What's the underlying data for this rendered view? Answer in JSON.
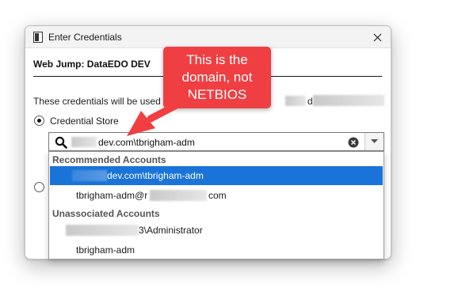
{
  "window": {
    "title": "Enter Credentials",
    "app_icon": "door-icon",
    "close_icon": "close-icon"
  },
  "header": {
    "title": "Web Jump: DataEDO DEV"
  },
  "description": {
    "text": "These credentials will be used to",
    "tail": "d"
  },
  "options": {
    "credential_store_label": "Credential Store"
  },
  "combo": {
    "value": "dev.com\\tbrigham-adm",
    "search_icon": "search-icon",
    "clear_icon": "clear-icon",
    "dropdown_icon": "chevron-down-icon"
  },
  "dropdown": {
    "recommended_header": "Recommended Accounts",
    "recommended_items": [
      {
        "text": "dev.com\\tbrigham-adm",
        "selected": true
      },
      {
        "text_prefix": "tbrigham-adm@r",
        "text_suffix": "com",
        "selected": false
      }
    ],
    "unassociated_header": "Unassociated Accounts",
    "unassociated_items": [
      {
        "text": "3\\Administrator"
      },
      {
        "text": "tbrigham-adm"
      }
    ]
  },
  "callout": {
    "lines": [
      "This is the",
      "domain, not",
      "NETBIOS"
    ]
  },
  "colors": {
    "accent_selection": "#1a73d9",
    "callout_red": "#ef3f42"
  }
}
